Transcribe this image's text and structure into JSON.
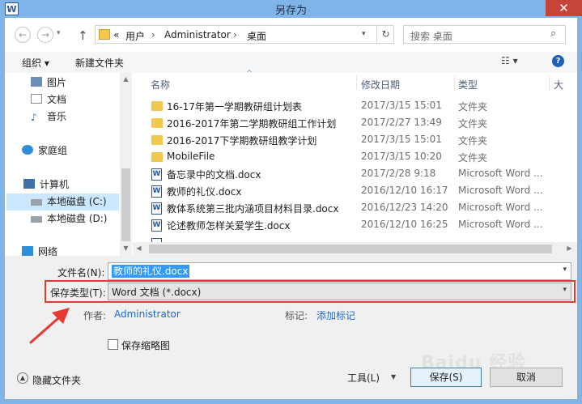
{
  "window": {
    "title": "另存为",
    "app_icon_letter": "W",
    "close_glyph": "✕"
  },
  "nav": {
    "back_glyph": "←",
    "forward_glyph": "→",
    "up_glyph": "↑",
    "breadcrumb": [
      "«",
      "用户",
      "›",
      "Administrator",
      "›",
      "桌面"
    ],
    "refresh_glyph": "↻",
    "dropdown_glyph": "▾",
    "search_placeholder": "搜索 桌面",
    "search_glyph": "⌕"
  },
  "toolbar": {
    "organize": "组织 ▾",
    "new_folder": "新建文件夹",
    "view_glyph": "☷ ▾",
    "help": "?"
  },
  "sidebar": {
    "items": [
      {
        "label": "图片",
        "icon": "pictures-icon"
      },
      {
        "label": "文档",
        "icon": "documents-icon"
      },
      {
        "label": "音乐",
        "icon": "music-icon"
      },
      {
        "label": "家庭组",
        "icon": "homegroup-icon"
      },
      {
        "label": "计算机",
        "icon": "computer-icon"
      },
      {
        "label": "本地磁盘 (C:)",
        "icon": "drive-icon"
      },
      {
        "label": "本地磁盘 (D:)",
        "icon": "drive-icon"
      },
      {
        "label": "网络",
        "icon": "network-icon"
      }
    ],
    "selected": "本地磁盘 (C:)"
  },
  "file_list": {
    "columns": {
      "name": "名称",
      "date": "修改日期",
      "type": "类型",
      "size": "大"
    },
    "sort_glyph": "^",
    "rows": [
      {
        "kind": "folder",
        "name": "16-17年第一学期教研组计划表",
        "date": "2017/3/15 15:01",
        "type": "文件夹"
      },
      {
        "kind": "folder",
        "name": "2016-2017年第二学期教研组工作计划",
        "date": "2017/2/27 13:49",
        "type": "文件夹"
      },
      {
        "kind": "folder",
        "name": "2016-2017下学期教研组教学计划",
        "date": "2017/3/15 15:01",
        "type": "文件夹"
      },
      {
        "kind": "folder",
        "name": "MobileFile",
        "date": "2017/3/15 10:20",
        "type": "文件夹"
      },
      {
        "kind": "doc",
        "name": "备忘录中的文档.docx",
        "date": "2017/2/28 9:18",
        "type": "Microsoft Word ..."
      },
      {
        "kind": "doc",
        "name": "教师的礼仪.docx",
        "date": "2016/12/10 16:17",
        "type": "Microsoft Word ..."
      },
      {
        "kind": "doc",
        "name": "教体系统第三批内涵项目材料目录.docx",
        "date": "2016/12/23 14:20",
        "type": "Microsoft Word ..."
      },
      {
        "kind": "doc",
        "name": "论述教师怎样关爱学生.docx",
        "date": "2016/12/10 16:25",
        "type": "Microsoft Word ..."
      }
    ]
  },
  "form": {
    "filename_label": "文件名(N):",
    "filename_value": "教师的礼仪.docx",
    "filetype_label": "保存类型(T):",
    "filetype_value": "Word 文档 (*.docx)",
    "author_label": "作者:",
    "author_value": "Administrator",
    "tags_label": "标记:",
    "tags_value": "添加标记",
    "thumbnail_label": "保存缩略图"
  },
  "footer": {
    "hide_folders": "隐藏文件夹",
    "tools": "工具(L)",
    "tools_arrow": "▼",
    "save": "保存(S)",
    "cancel": "取消"
  },
  "annotation": {
    "color": "#e53935"
  },
  "watermark": "Baidu 经验",
  "colors": {
    "titlebar": "#7fb4e8",
    "accent": "#1b6ac9",
    "highlight_box": "#e53935"
  }
}
